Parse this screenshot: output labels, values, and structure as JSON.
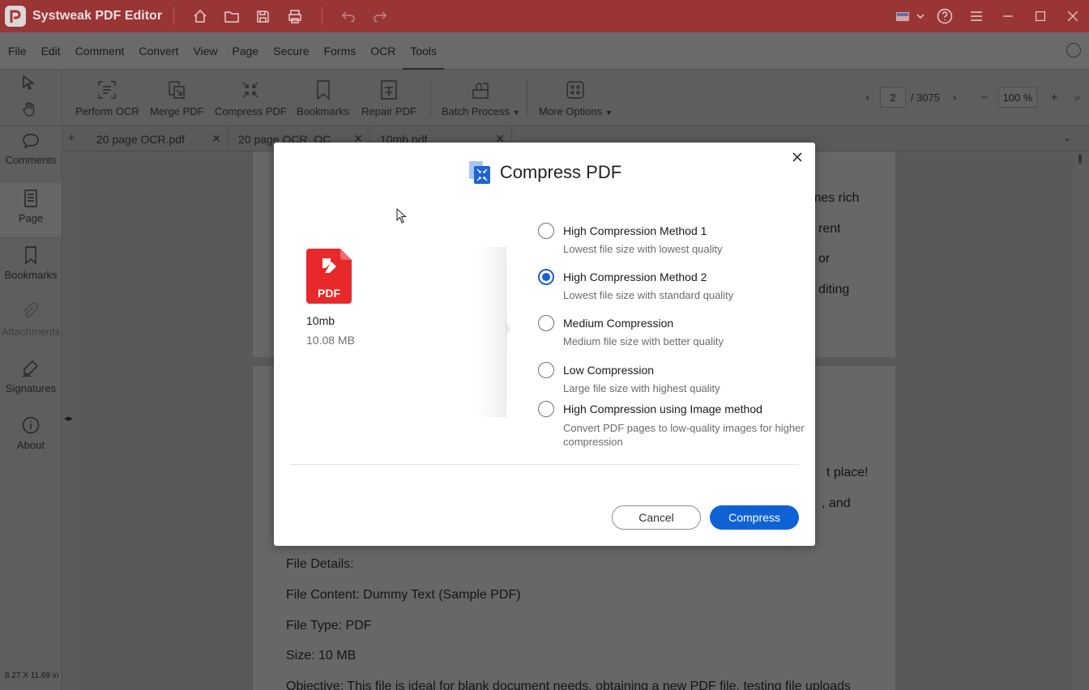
{
  "app": {
    "title": "Systweak PDF Editor"
  },
  "menu": [
    "File",
    "Edit",
    "Comment",
    "Convert",
    "View",
    "Page",
    "Secure",
    "Forms",
    "OCR",
    "Tools"
  ],
  "menu_active": "Tools",
  "toolbar": {
    "tools": [
      "Perform OCR",
      "Merge PDF",
      "Compress PDF",
      "Bookmarks",
      "Repair PDF"
    ],
    "batch_label": "Batch Process",
    "more_label": "More Options"
  },
  "pager": {
    "current_page": "2",
    "total": "/ 3075",
    "zoom": "100 %"
  },
  "sidebar": {
    "items": [
      "Comments",
      "Page",
      "Bookmarks",
      "Attachments",
      "Signatures",
      "About"
    ],
    "active": "Page",
    "page_size": "8.27 X 11.69 in"
  },
  "tabs": [
    "20 page OCR.pdf",
    "20 page OCR_OC",
    "10mb.pdf"
  ],
  "document": {
    "lines_top": [
      "mes rich",
      "rent",
      "or",
      "diting"
    ],
    "lines_mid": [
      "t place!",
      ", and"
    ],
    "lines_bottom": [
      "File Details:",
      "File Content: Dummy Text (Sample PDF)",
      "File Type: PDF",
      "Size: 10 MB",
      "Objective: This file is ideal for blank document needs, obtaining a new PDF file, testing file uploads"
    ]
  },
  "dialog": {
    "title": "Compress PDF",
    "file": {
      "icon_label": "PDF",
      "name": "10mb",
      "size": "10.08 MB"
    },
    "options": [
      {
        "title": "High Compression Method 1",
        "desc": "Lowest file size with lowest quality",
        "checked": false
      },
      {
        "title": "High Compression Method 2",
        "desc": "Lowest file size with standard quality",
        "checked": true
      },
      {
        "title": "Medium Compression",
        "desc": "Medium file size with better quality",
        "checked": false
      },
      {
        "title": "Low Compression",
        "desc": "Large file size with highest quality",
        "checked": false
      },
      {
        "title": "High Compression using Image method",
        "desc": "Convert PDF pages to low-quality images for higher compression",
        "checked": false
      }
    ],
    "cancel_label": "Cancel",
    "compress_label": "Compress"
  },
  "colors": {
    "titlebar": "#9a3536",
    "accent": "#0f62d6",
    "pdf_red": "#e8292b"
  }
}
